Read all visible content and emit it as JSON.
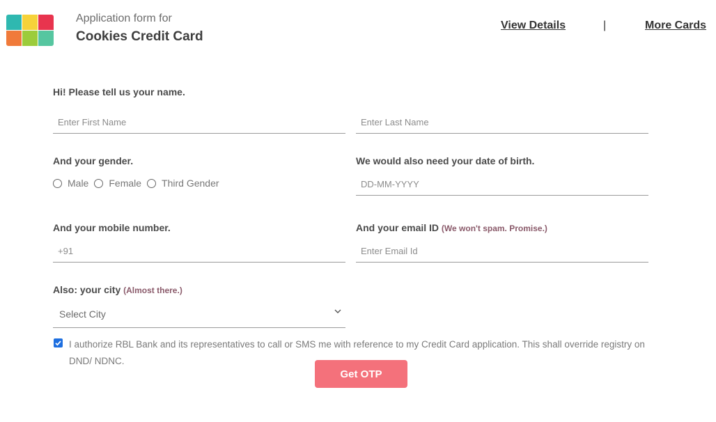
{
  "header": {
    "subtitle": "Application form for",
    "title": "Cookies Credit Card",
    "links": {
      "view_details": "View Details",
      "separator": "|",
      "more_cards": "More Cards"
    }
  },
  "form": {
    "name_section": {
      "label": "Hi! Please tell us your name.",
      "first_name_placeholder": "Enter First Name",
      "last_name_placeholder": "Enter Last Name"
    },
    "gender_section": {
      "label": "And your gender.",
      "options": [
        "Male",
        "Female",
        "Third Gender"
      ]
    },
    "dob_section": {
      "label": "We would also need your date of birth.",
      "placeholder": "DD-MM-YYYY"
    },
    "mobile_section": {
      "label": "And your mobile number.",
      "placeholder": "+91"
    },
    "email_section": {
      "label": "And your email ID",
      "hint": "(We won't spam. Promise.)",
      "placeholder": "Enter Email Id"
    },
    "city_section": {
      "label": "Also: your city",
      "hint": "(Almost there.)",
      "selected": "Select City"
    },
    "consent": {
      "checked": true,
      "text": "I authorize RBL Bank and its representatives to call or SMS me with reference to my Credit Card application. This shall override registry on DND/ NDNC."
    },
    "submit_label": "Get OTP"
  },
  "colors": {
    "button": "#f4717b",
    "hint": "#8a5a6a",
    "checkbox": "#1e6fe0"
  }
}
